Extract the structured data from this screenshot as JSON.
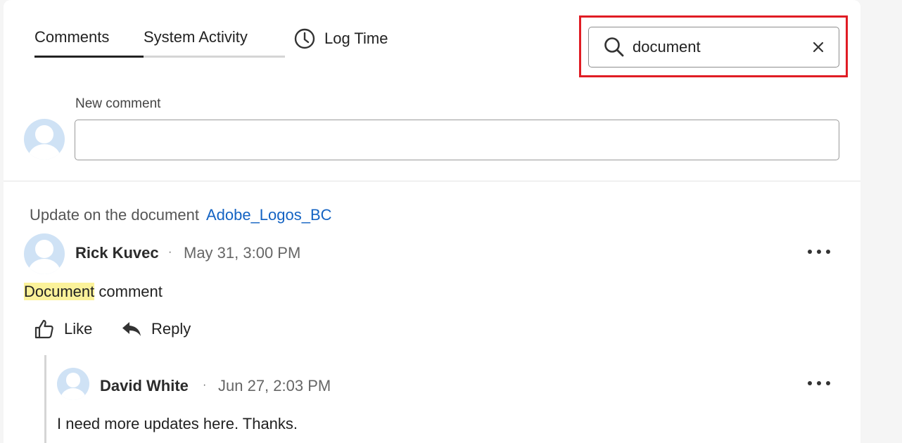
{
  "tabs": [
    {
      "label": "Comments",
      "active": true
    },
    {
      "label": "System Activity",
      "active": false
    }
  ],
  "log_time": {
    "label": "Log Time",
    "icon": "clock-icon"
  },
  "search": {
    "value": "document",
    "placeholder": "",
    "icon": "search-icon",
    "clear_icon": "close-icon"
  },
  "new_comment": {
    "label": "New comment",
    "value": ""
  },
  "thread": {
    "context_prefix": "Update on the document",
    "context_link": "Adobe_Logos_BC",
    "comment": {
      "author": "Rick Kuvec",
      "separator": "·",
      "time": "May 31, 3:00 PM",
      "text_highlight": "Document",
      "text_rest": " comment",
      "like_label": "Like",
      "reply_label": "Reply"
    },
    "reply": {
      "author": "David White",
      "separator": "·",
      "time": "Jun 27, 2:03 PM",
      "text": "I need more updates here. Thanks."
    }
  },
  "colors": {
    "accent_link": "#1463c3",
    "highlight": "#fbf29a",
    "focus_outline": "#e01c24",
    "avatar": "#cfe2f5"
  }
}
